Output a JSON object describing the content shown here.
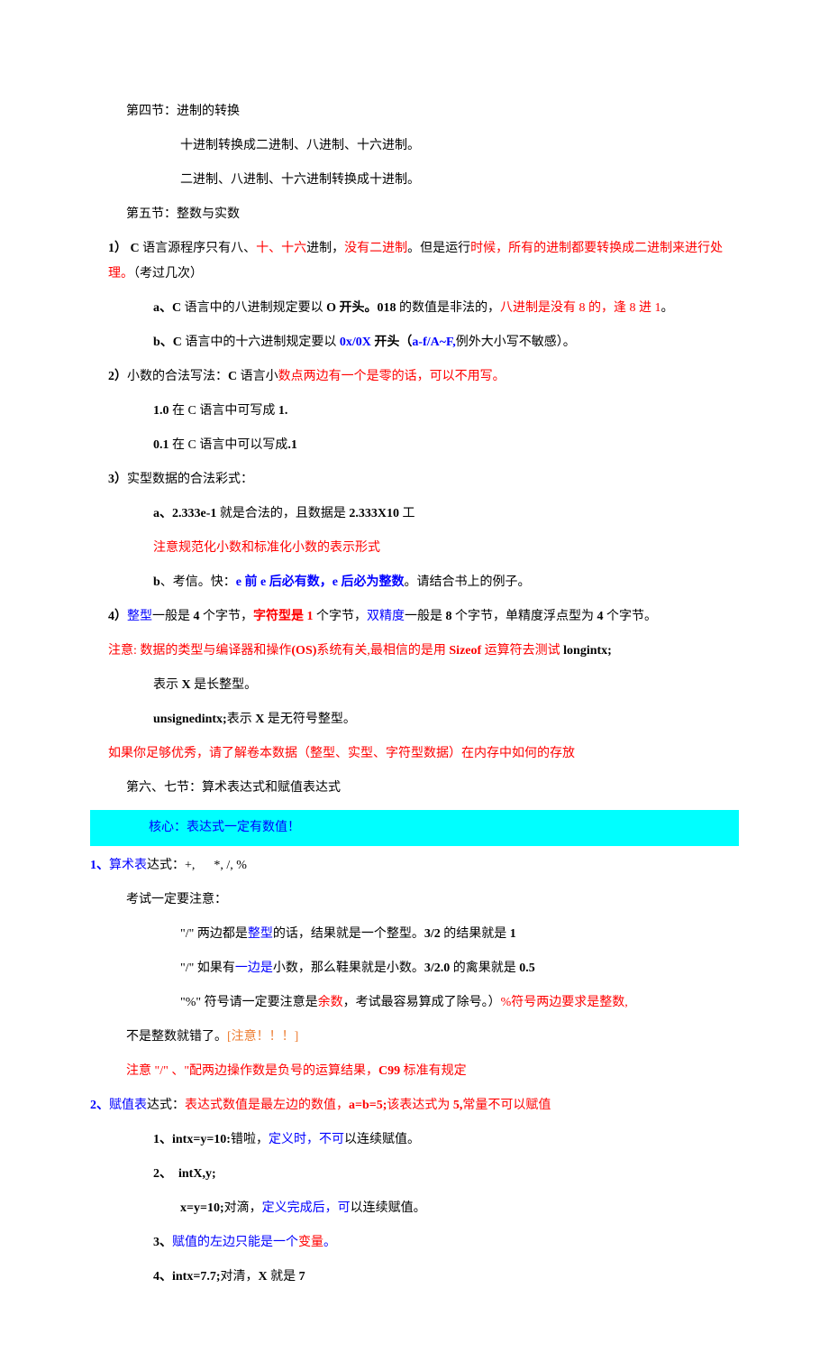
{
  "s4_title": "第四节：进制的转换",
  "s4_l1": "十进制转换成二进制、八进制、十六进制。",
  "s4_l2": "二进制、八进制、十六进制转换成十进制。",
  "s5_title": "第五节：整数与实数",
  "p1_a": "1）",
  "p1_b": "C",
  "p1_c": " 语言源程序只有八、",
  "p1_d": "十、十六",
  "p1_e": "进制，",
  "p1_f": "没有二进制",
  "p1_g": "。但是运行",
  "p1_h": "时候，所有的进制都要转换成二进制来进行处理。",
  "p1_i": "（考过几次）",
  "p2_a": "a、C",
  "p2_b": " 语言中的八进制规定要以 ",
  "p2_c": "O 开头。018",
  "p2_d": " 的数值是非法的，",
  "p2_e": "八进制是没有 8 的，逢 8 进 1",
  "p2_f": "。",
  "p3_a": "b、C",
  "p3_b": " 语言中的十六进制规定要以 ",
  "p3_c": "0x/0X",
  "p3_d": " 开头（",
  "p3_e": "a-f/A~F,",
  "p3_f": "例外大小写不敏感）。",
  "p4_a": "2）",
  "p4_b": "小数的合法写法：",
  "p4_c": "C",
  "p4_d": " 语言小",
  "p4_e": "数点两边有一个是零的话，可以不用写。",
  "p5_a": "1.0",
  "p5_b": " 在 C 语言中可写成 ",
  "p5_c": "1.",
  "p6_a": "0.1",
  "p6_b": " 在 C 语言中可以写成",
  "p6_c": ".1",
  "p7_a": "3）",
  "p7_b": "实型数据的合法彩式：",
  "p8_a": "a、2.333e-1",
  "p8_b": " 就是合法的，且数据是 ",
  "p8_c": "2.333X10",
  "p8_d": " 工",
  "p9": "注意规范化小数和标准化小数的表示形式",
  "p10_a": "b",
  "p10_b": "、考信。快：",
  "p10_c": "e 前 e 后必有数，e 后必为整数",
  "p10_d": "。请结合书上的例子。",
  "p11_a": "4）",
  "p11_b": "整型",
  "p11_c": "一般是 ",
  "p11_d": "4",
  "p11_e": " 个字节，",
  "p11_f": "字符型是 1",
  "p11_g": " 个字节，",
  "p11_h": "双精度",
  "p11_i": "一般是 ",
  "p11_j": "8",
  "p11_k": " 个字节，单精度浮点型为 ",
  "p11_l": "4",
  "p11_m": " 个字节。",
  "p12_a": "注意: 数据的类型与编译器和操作",
  "p12_b": "(OS)",
  "p12_c": "系统有关,最相信的是用 ",
  "p12_d": "Sizeof",
  "p12_e": " 运算符去测试 ",
  "p12_f": "longintx;",
  "p13_a": "表示 ",
  "p13_b": "X",
  "p13_c": " 是长整型。",
  "p14_a": "unsignedintx;",
  "p14_b": "表示 ",
  "p14_c": "X",
  "p14_d": " 是无符号整型。",
  "p15": "如果你足够优秀，请了解卷本数据（整型、实型、字符型数据）在内存中如何的存放",
  "s67_title": "第六、七节：算术表达式和赋值表达式",
  "core": "核心：表达式一定有数值！",
  "a1_a": "1、",
  "a1_b": "算术表",
  "a1_c": "达式：+,",
  "a1_d": "*, /, %",
  "a2": "考试一定要注意：",
  "a3_a": "\"/\" 两边都是",
  "a3_b": "整型",
  "a3_c": "的话，结果就是一个整型。",
  "a3_d": "3/2",
  "a3_e": " 的结果就是 ",
  "a3_f": "1",
  "a4_a": "\"/\" 如果有",
  "a4_b": "一边是",
  "a4_c": "小数，那么鞋果就是小数。",
  "a4_d": "3/2.0",
  "a4_e": " 的禽果就是 ",
  "a4_f": "0.5",
  "a5_a": "\"%\" 符号请一定要注意是",
  "a5_b": "余数",
  "a5_c": "，考试最容易算成了除号。）",
  "a5_d": "%符号两边要求是整数,",
  "a5_e": "不是整数就错了。",
  "a5_f": "[注意！！！]",
  "a6_a": "注意 \"/\" 、\"配两边操作数是负号的运算结果，",
  "a6_b": "C99",
  "a6_c": " 标准有规定",
  "b1_a": "2、",
  "b1_b": "赋值表",
  "b1_c": "达式：",
  "b1_d": "表达式数值是最左边的数值，",
  "b1_e": "a=b=5;",
  "b1_f": "该表达式为 ",
  "b1_g": "5,",
  "b1_h": "常量不可以赋值",
  "b2_a": "1、intx=y=10:",
  "b2_b": "错啦，",
  "b2_c": "定义时，不可",
  "b2_d": "以连续赋值。",
  "b3_a": "2、",
  "b3_b": "intX,y;",
  "b4_a": "x=y=10;",
  "b4_b": "对滴，",
  "b4_c": "定义完成后，可",
  "b4_d": "以连续赋值。",
  "b5_a": "3、",
  "b5_b": "赋值的左边只能是一个",
  "b5_c": "变量",
  "b5_d": "。",
  "b6_a": "4、intx=7.7;",
  "b6_b": "对清，",
  "b6_c": "X",
  "b6_d": " 就是 ",
  "b6_e": "7"
}
